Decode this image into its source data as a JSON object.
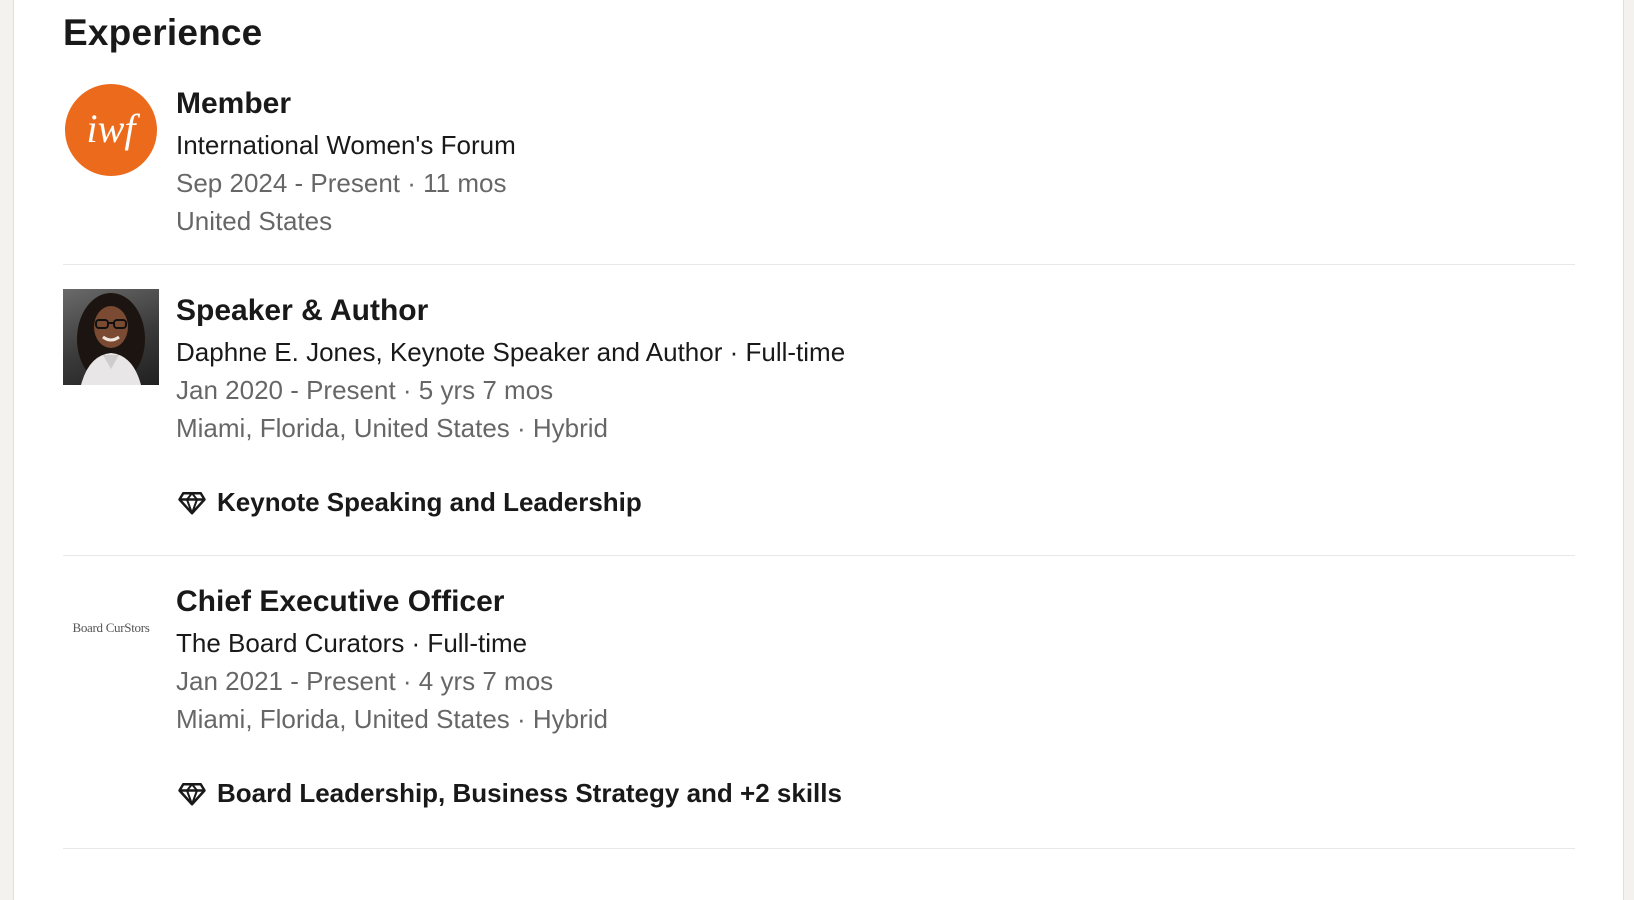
{
  "section": {
    "title": "Experience"
  },
  "entries": [
    {
      "logo_icon": "iwf-logo-icon",
      "logo_text": "iwf",
      "logo_color": "#ec6a1c",
      "title": "Member",
      "company": "International Women's Forum",
      "dates": "Sep 2024 - Present · 11 mos",
      "location": "United States"
    },
    {
      "logo_icon": "profile-photo-icon",
      "title": "Speaker & Author",
      "company": "Daphne E. Jones, Keynote Speaker and Author · Full-time",
      "dates": "Jan 2020 - Present · 5 yrs 7 mos",
      "location": "Miami, Florida, United States · Hybrid",
      "skills": "Keynote Speaking and Leadership"
    },
    {
      "logo_icon": "board-curators-logo-icon",
      "logo_text": "Board CurStors",
      "title": "Chief Executive Officer",
      "company": "The Board Curators · Full-time",
      "dates": "Jan 2021 - Present · 4 yrs 7 mos",
      "location": "Miami, Florida, United States · Hybrid",
      "skills": "Board Leadership, Business Strategy and +2 skills"
    }
  ],
  "icons": {
    "skills": "diamond-icon"
  }
}
